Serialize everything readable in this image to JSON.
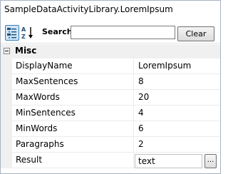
{
  "window": {
    "title": "SampleDataActivityLibrary.LoremIpsum"
  },
  "toolbar": {
    "categorized_icon": "categorized-view-icon",
    "alphabetical_icon": "sort-alphabetical-icon",
    "search_label": "Search:",
    "search_value": "",
    "clear_label": "Clear"
  },
  "grid": {
    "category": {
      "label": "Misc",
      "expanded": true
    },
    "properties": [
      {
        "name": "DisplayName",
        "value": "LoremIpsum"
      },
      {
        "name": "MaxSentences",
        "value": "8"
      },
      {
        "name": "MaxWords",
        "value": "20"
      },
      {
        "name": "MinSentences",
        "value": "4"
      },
      {
        "name": "MinWords",
        "value": "6"
      },
      {
        "name": "Paragraphs",
        "value": "2"
      },
      {
        "name": "Result",
        "value": "text",
        "editor_button": "..."
      }
    ]
  },
  "colors": {
    "accent": "#3c7fb1",
    "category_bg": "#f0f0f0",
    "border": "#a9b3c1"
  }
}
